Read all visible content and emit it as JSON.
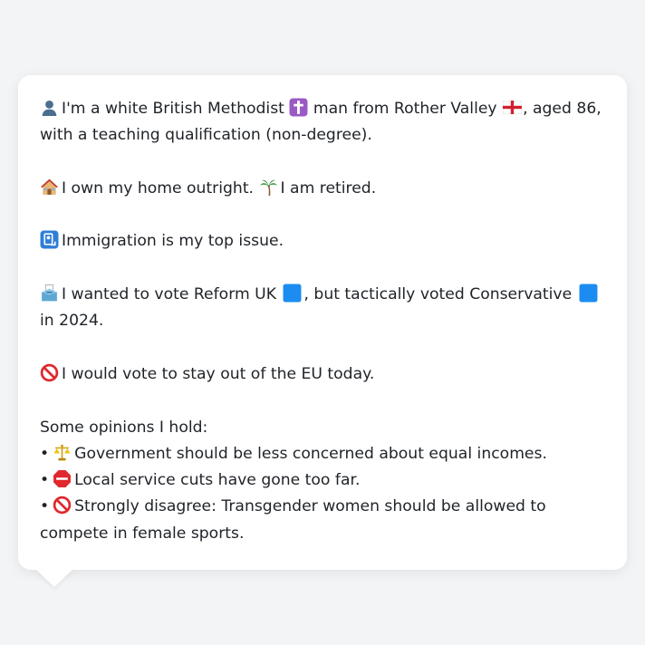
{
  "profile": {
    "line1_pre": "I'm a white British Methodist",
    "line1_mid": "man from Rother Valley",
    "line1_post": ", aged 86, with a teaching qualification (non-degree).",
    "home_text": "I own my home outright.",
    "retired_text": "I am retired.",
    "issue_text": "Immigration is my top issue.",
    "vote_pre": "I wanted to vote Reform UK",
    "vote_mid": ", but tactically voted Conservative",
    "vote_post": "in 2024.",
    "eu_text": "I would vote to stay out of the EU today."
  },
  "opinions": {
    "heading": "Some opinions I hold:",
    "items": [
      {
        "text": "Government should be less concerned about equal incomes.",
        "icon": "scales-icon"
      },
      {
        "text": "Local service cuts have gone too far.",
        "icon": "stop-sign-icon"
      },
      {
        "text": "Strongly disagree: Transgender women should be allowed to compete in female sports.",
        "icon": "prohibited-icon"
      }
    ],
    "bullet": "•"
  },
  "colors": {
    "card_bg": "#ffffff",
    "page_bg": "#f3f4f6",
    "reform_blue": "#1d8cf0",
    "conservative_blue": "#1d8cf0",
    "text": "#1f2328"
  }
}
